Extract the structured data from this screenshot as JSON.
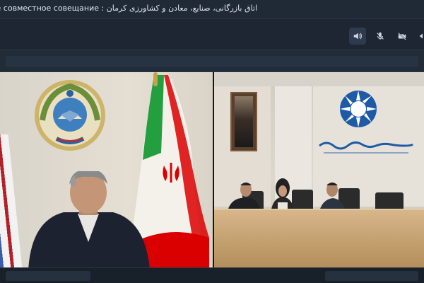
{
  "window": {
    "title": "اتاق بازرگانی، صنایع، معادن و کشاورزی کرمان : керманско-узбекистанское совместное совещание"
  },
  "toolbar": {
    "buttons": [
      {
        "name": "speaker-icon",
        "active": true
      },
      {
        "name": "mic-off-icon",
        "active": false
      },
      {
        "name": "camera-off-icon",
        "active": false
      },
      {
        "name": "share-icon",
        "active": false
      }
    ]
  },
  "colors": {
    "background": "#1b2431",
    "toolbar": "#1e2633",
    "accent": "#dfe5ee",
    "iran_green": "#239f40",
    "iran_red": "#da0000",
    "logo_blue": "#1f5aa6"
  },
  "videos": [
    {
      "name": "participant-left",
      "content": "official-at-desk-with-flags"
    },
    {
      "name": "participant-right",
      "content": "conference-room-three-participants"
    }
  ]
}
